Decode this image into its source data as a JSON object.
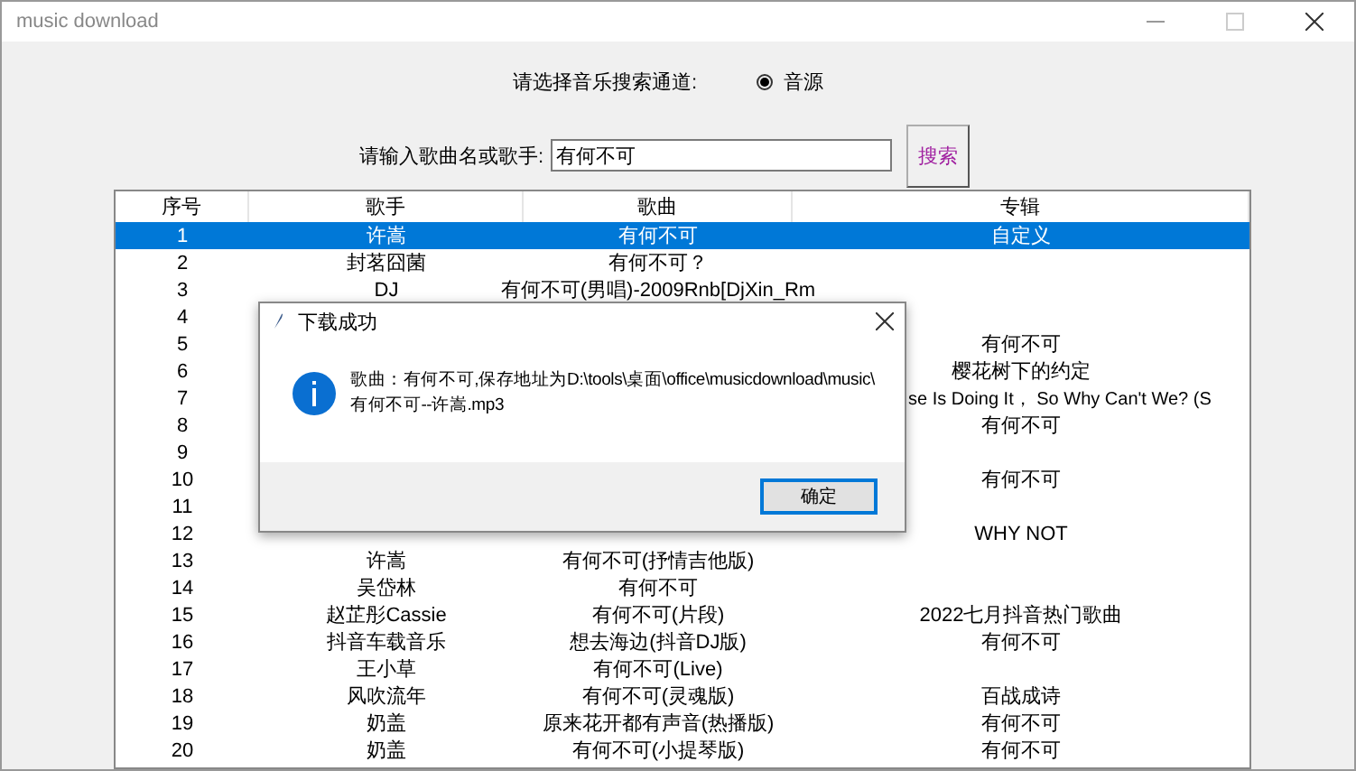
{
  "window": {
    "title": "music download"
  },
  "channel": {
    "label": "请选择音乐搜索通道:",
    "options": [
      {
        "label": "音源",
        "selected": true
      }
    ]
  },
  "search": {
    "label": "请输入歌曲名或歌手:",
    "value": "有何不可",
    "button": "搜索"
  },
  "table": {
    "columns": [
      "序号",
      "歌手",
      "歌曲",
      "专辑"
    ],
    "rows": [
      {
        "no": "1",
        "singer": "许嵩",
        "song": "有何不可",
        "album": "自定义",
        "selected": true
      },
      {
        "no": "2",
        "singer": "封茗囧菌",
        "song": "有何不可？",
        "selected": false
      },
      {
        "no": "3",
        "singer": "DJ",
        "song": "有何不可(男唱)-2009Rnb[DjXin_Rm",
        "selected": false
      },
      {
        "no": "4",
        "selected": false
      },
      {
        "no": "5",
        "album": "有何不可",
        "selected": false
      },
      {
        "no": "6",
        "album": "樱花树下的约定",
        "selected": false
      },
      {
        "no": "7",
        "album": "se Is Doing It， So Why Can't We? (S",
        "album_cut": true,
        "selected": false
      },
      {
        "no": "8",
        "album": "有何不可",
        "selected": false
      },
      {
        "no": "9",
        "selected": false
      },
      {
        "no": "10",
        "album": "有何不可",
        "selected": false
      },
      {
        "no": "11",
        "selected": false
      },
      {
        "no": "12",
        "album": "WHY NOT",
        "selected": false
      },
      {
        "no": "13",
        "singer": "许嵩",
        "song": "有何不可(抒情吉他版)",
        "selected": false
      },
      {
        "no": "14",
        "singer": "吴岱林",
        "song": "有何不可",
        "selected": false
      },
      {
        "no": "15",
        "singer": "赵芷彤Cassie",
        "song": "有何不可(片段)",
        "album": "2022七月抖音热门歌曲",
        "selected": false
      },
      {
        "no": "16",
        "singer": "抖音车载音乐",
        "song": "想去海边(抖音DJ版)",
        "album": "有何不可",
        "selected": false
      },
      {
        "no": "17",
        "singer": "王小草",
        "song": "有何不可(Live)",
        "selected": false
      },
      {
        "no": "18",
        "singer": "风吹流年",
        "song": "有何不可(灵魂版)",
        "album": "百战成诗",
        "selected": false
      },
      {
        "no": "19",
        "singer": "奶盖",
        "song": "原来花开都有声音(热播版)",
        "album": "有何不可",
        "selected": false
      },
      {
        "no": "20",
        "singer": "奶盖",
        "song": "有何不可(小提琴版)",
        "album": "有何不可",
        "selected": false
      }
    ]
  },
  "dialog": {
    "title": "下载成功",
    "message": "歌曲：有何不可,保存地址为D:\\tools\\桌面\\office\\musicdownload\\music\\\n有何不可--许嵩.mp3",
    "button": "确定"
  }
}
